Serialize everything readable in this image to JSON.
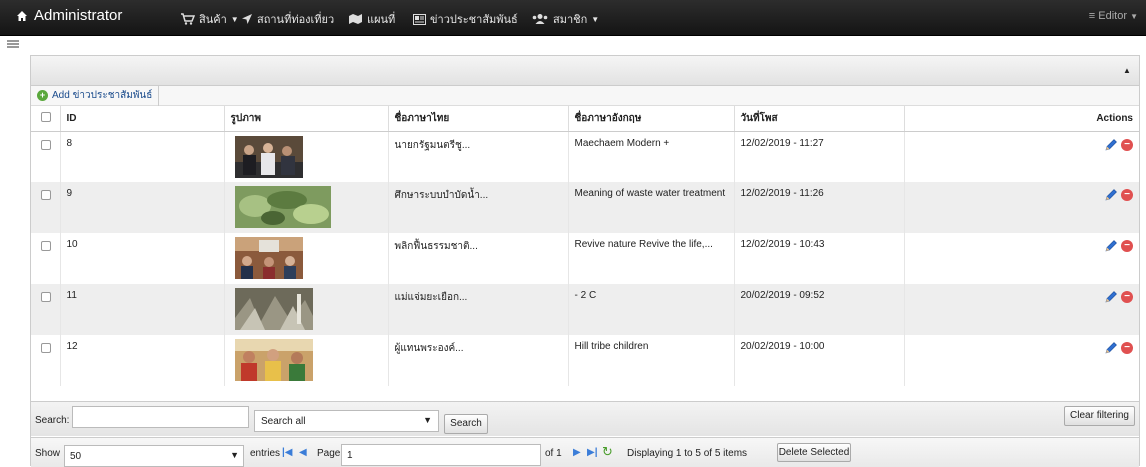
{
  "navbar": {
    "brand": "Administrator",
    "items": [
      {
        "label": "สินค้า",
        "icon": "cart-icon",
        "caret": true
      },
      {
        "label": "สถานที่ท่องเที่ยว",
        "icon": "location-arrow-icon",
        "caret": false
      },
      {
        "label": "แผนที่",
        "icon": "map-icon",
        "caret": false
      },
      {
        "label": "ข่าวประชาสัมพันธ์",
        "icon": "news-icon",
        "caret": false
      },
      {
        "label": "สมาชิก",
        "icon": "users-icon",
        "caret": true
      }
    ],
    "user": "Editor"
  },
  "toolbar": {
    "add_label": "Add ข่าวประชาสัมพันธ์"
  },
  "table": {
    "columns": [
      "ID",
      "รูปภาพ",
      "ชื่อภาษาไทย",
      "ชื่อภาษาอังกฤษ",
      "วันที่โพส",
      "Actions"
    ],
    "rows": [
      {
        "id": "8",
        "image": "news-photo-people",
        "th": "นายกรัฐมนตรีชู...",
        "en": "Maechaem Modern +",
        "date": "12/02/2019 - 11:27"
      },
      {
        "id": "9",
        "image": "news-photo-water",
        "th": "ศึกษาระบบบำบัดน้ำ...",
        "en": "Meaning of waste water treatment",
        "date": "12/02/2019 - 11:26"
      },
      {
        "id": "10",
        "image": "news-photo-meeting",
        "th": "พลิกฟื้นธรรมชาติ...",
        "en": "Revive nature Revive the life,...",
        "date": "12/02/2019 - 10:43"
      },
      {
        "id": "11",
        "image": "news-photo-forest",
        "th": "แม่แจ่มยะเยือก...",
        "en": "- 2 C",
        "date": "20/02/2019 - 09:52"
      },
      {
        "id": "12",
        "image": "news-photo-children",
        "th": "ผู้แทนพระองค์...",
        "en": "Hill tribe children",
        "date": "20/02/2019 - 10:00"
      }
    ]
  },
  "search": {
    "label": "Search:",
    "value": "",
    "scope": "Search all",
    "button": "Search",
    "clear_button": "Clear filtering"
  },
  "footer": {
    "show_label": "Show",
    "show_value": "50",
    "entries_label": "entries",
    "page_label": "Page",
    "page_value": "1",
    "of_label": "of 1",
    "display_text": "Displaying 1 to 5 of 5 items",
    "delete_button": "Delete Selected"
  },
  "colors": {
    "navbar": "#1f1f1f",
    "row_alt": "#eeeeee",
    "link": "#1a4b8c",
    "delete": "#e05050",
    "add": "#5aa83c"
  }
}
